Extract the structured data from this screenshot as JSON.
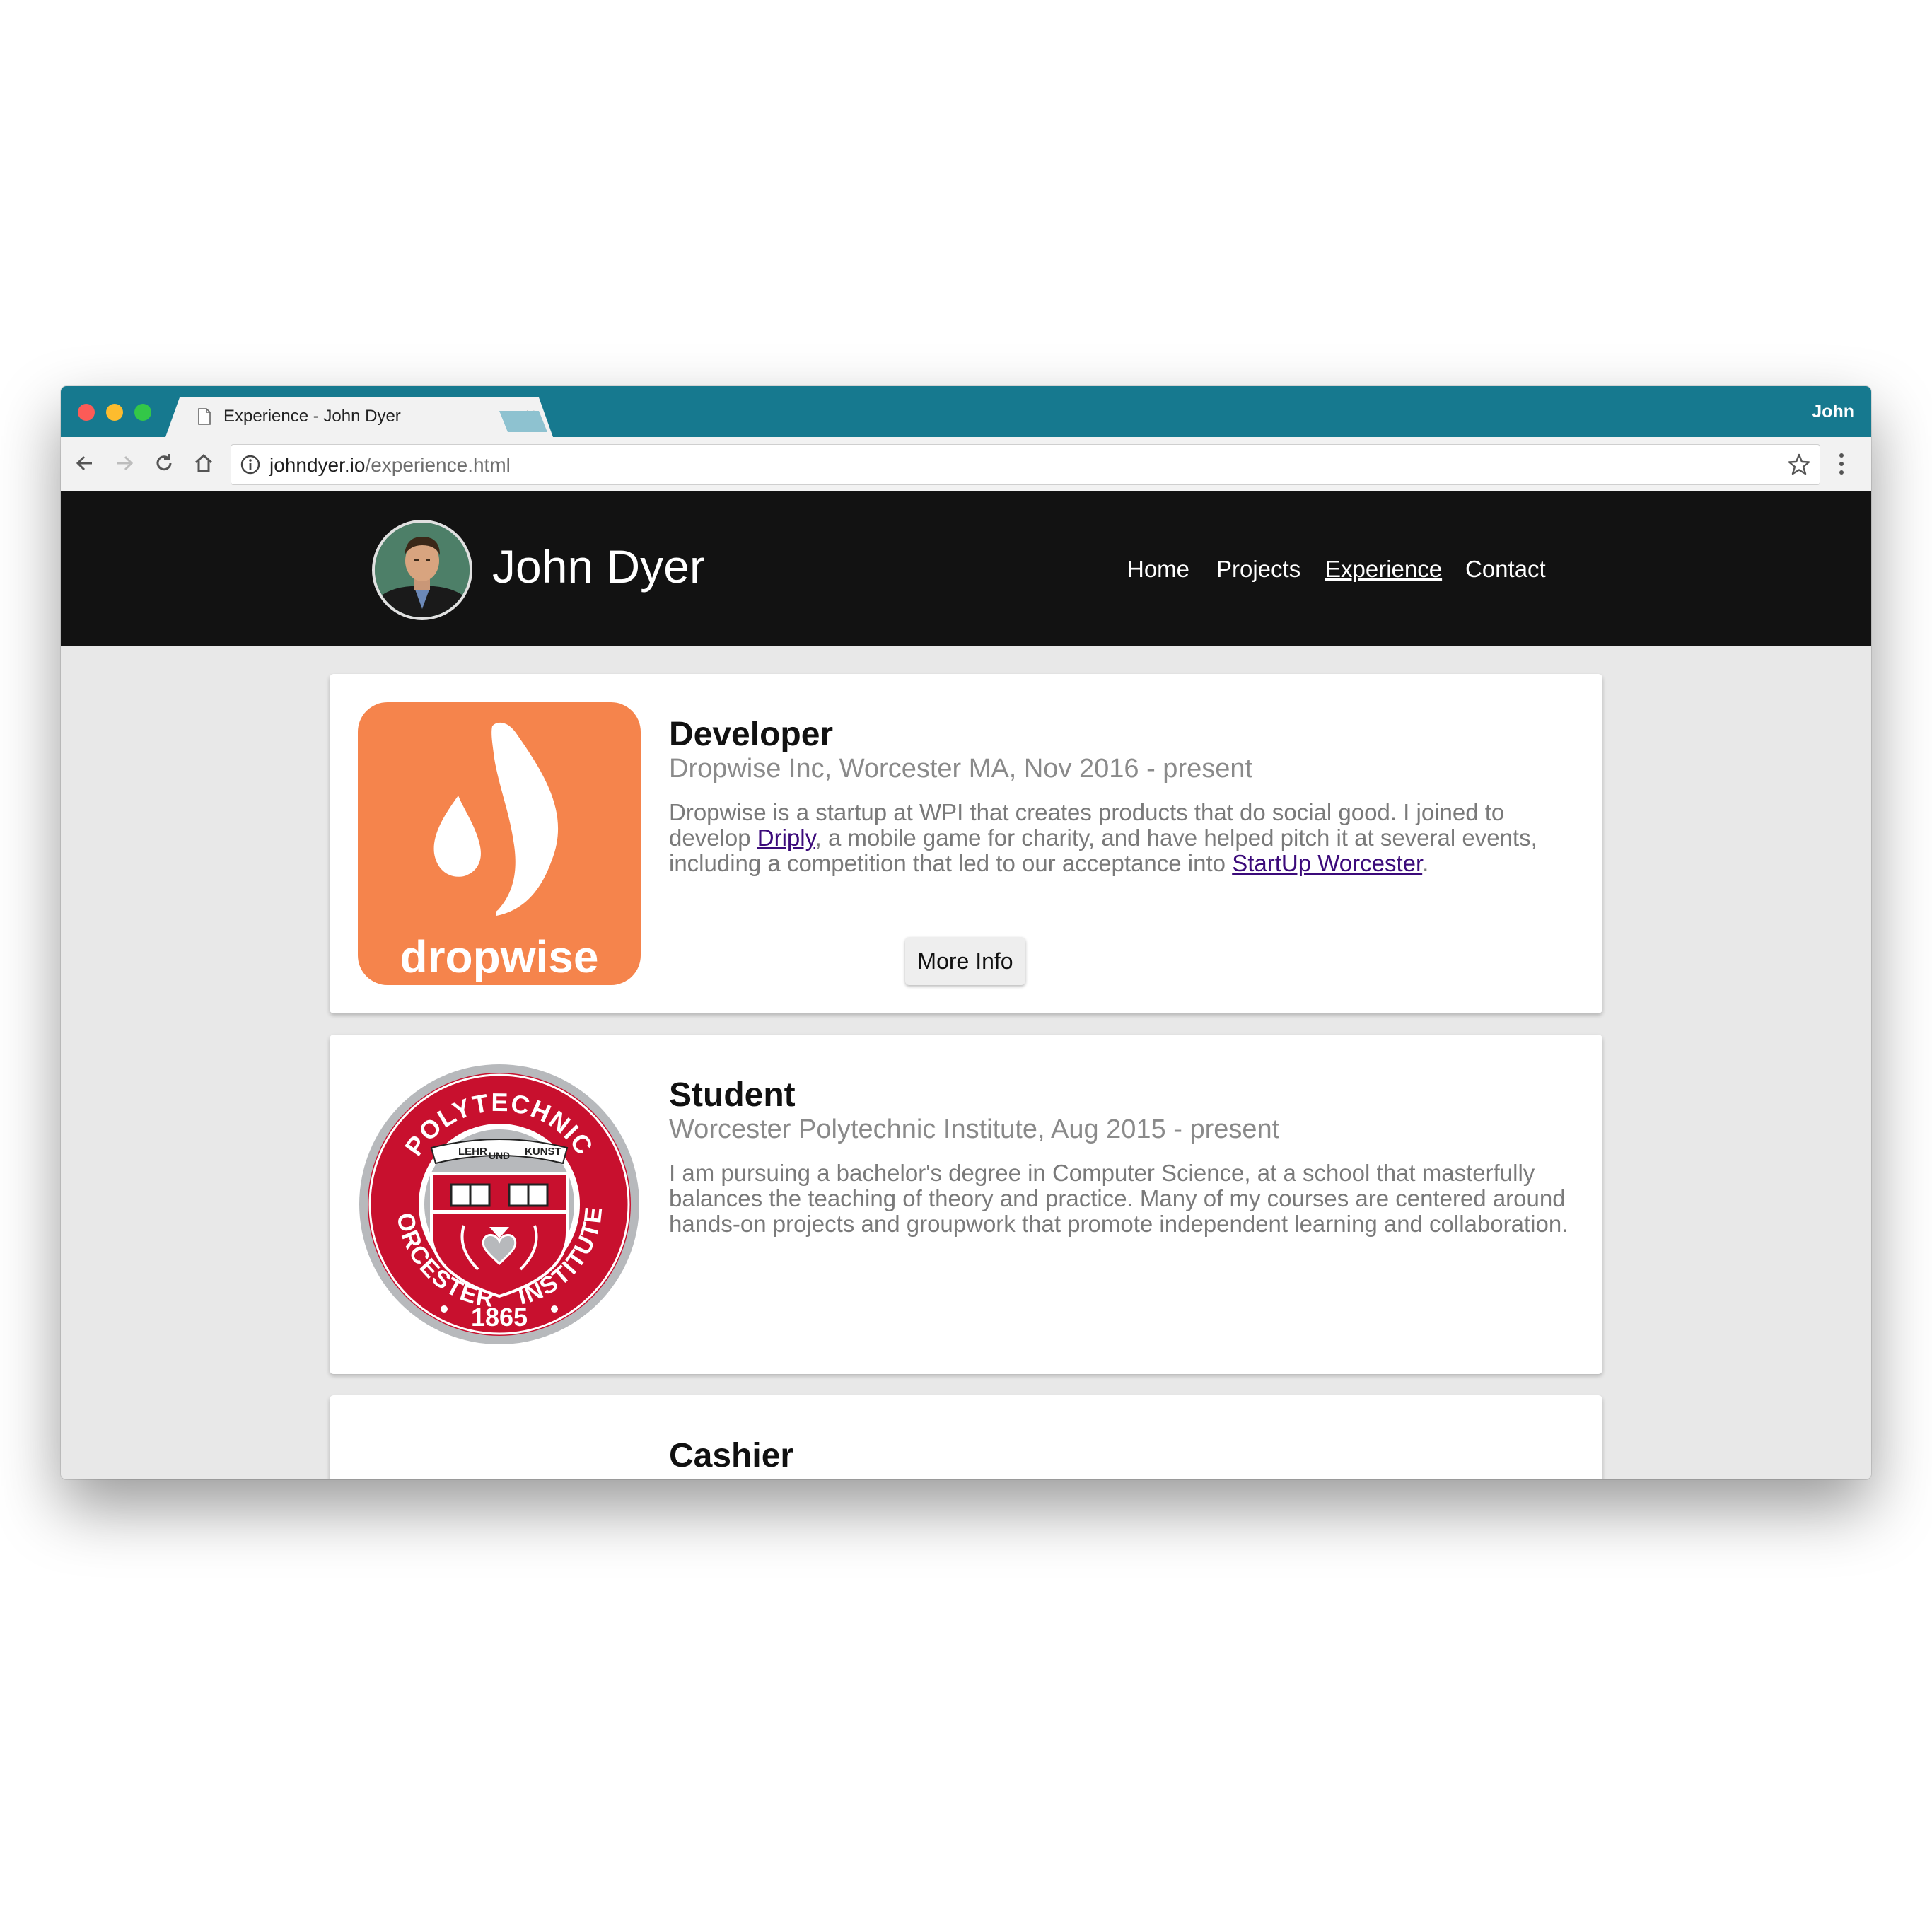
{
  "browser": {
    "tab_title": "Experience - John Dyer",
    "tab_close": "×",
    "profile_name": "John",
    "url_host": "johndyer.io",
    "url_path": "/experience.html"
  },
  "site": {
    "title": "John Dyer",
    "nav": [
      "Home",
      "Projects",
      "Experience",
      "Contact"
    ],
    "active_nav": "Experience"
  },
  "cards": [
    {
      "title": "Developer",
      "subtitle": "Dropwise Inc, Worcester MA, Nov 2016 - present",
      "desc_part1": "Dropwise is a startup at WPI that creates products that do social good. I joined to develop ",
      "desc_link1": "Driply",
      "desc_part2": ", a mobile game for charity, and have helped pitch it at several events, including a competition that led to our acceptance into ",
      "desc_link2": "StartUp Worcester",
      "desc_part3": ".",
      "logo_text": "dropwise",
      "button": "More Info"
    },
    {
      "title": "Student",
      "subtitle": "Worcester Polytechnic Institute, Aug 2015 - present",
      "desc": "I am pursuing a bachelor's degree in Computer Science, at a school that masterfully balances the teaching of theory and practice. Many of my courses are centered around hands-on projects and groupwork that promote independent learning and collaboration.",
      "seal": {
        "ring_top": "POLYTECHNIC",
        "ring_left": "WORCESTER",
        "ring_right": "INSTITUTE",
        "year": "1865",
        "motto_1": "LEHR",
        "motto_2": "UND",
        "motto_3": "KUNST"
      }
    },
    {
      "title": "Cashier"
    }
  ],
  "colors": {
    "titlebar": "#16798f",
    "header_bg": "#121212",
    "page_bg": "#e8e8e8",
    "dropwise_orange": "#f5844c",
    "wpi_red": "#c8102e",
    "link": "#3b0a7a"
  }
}
